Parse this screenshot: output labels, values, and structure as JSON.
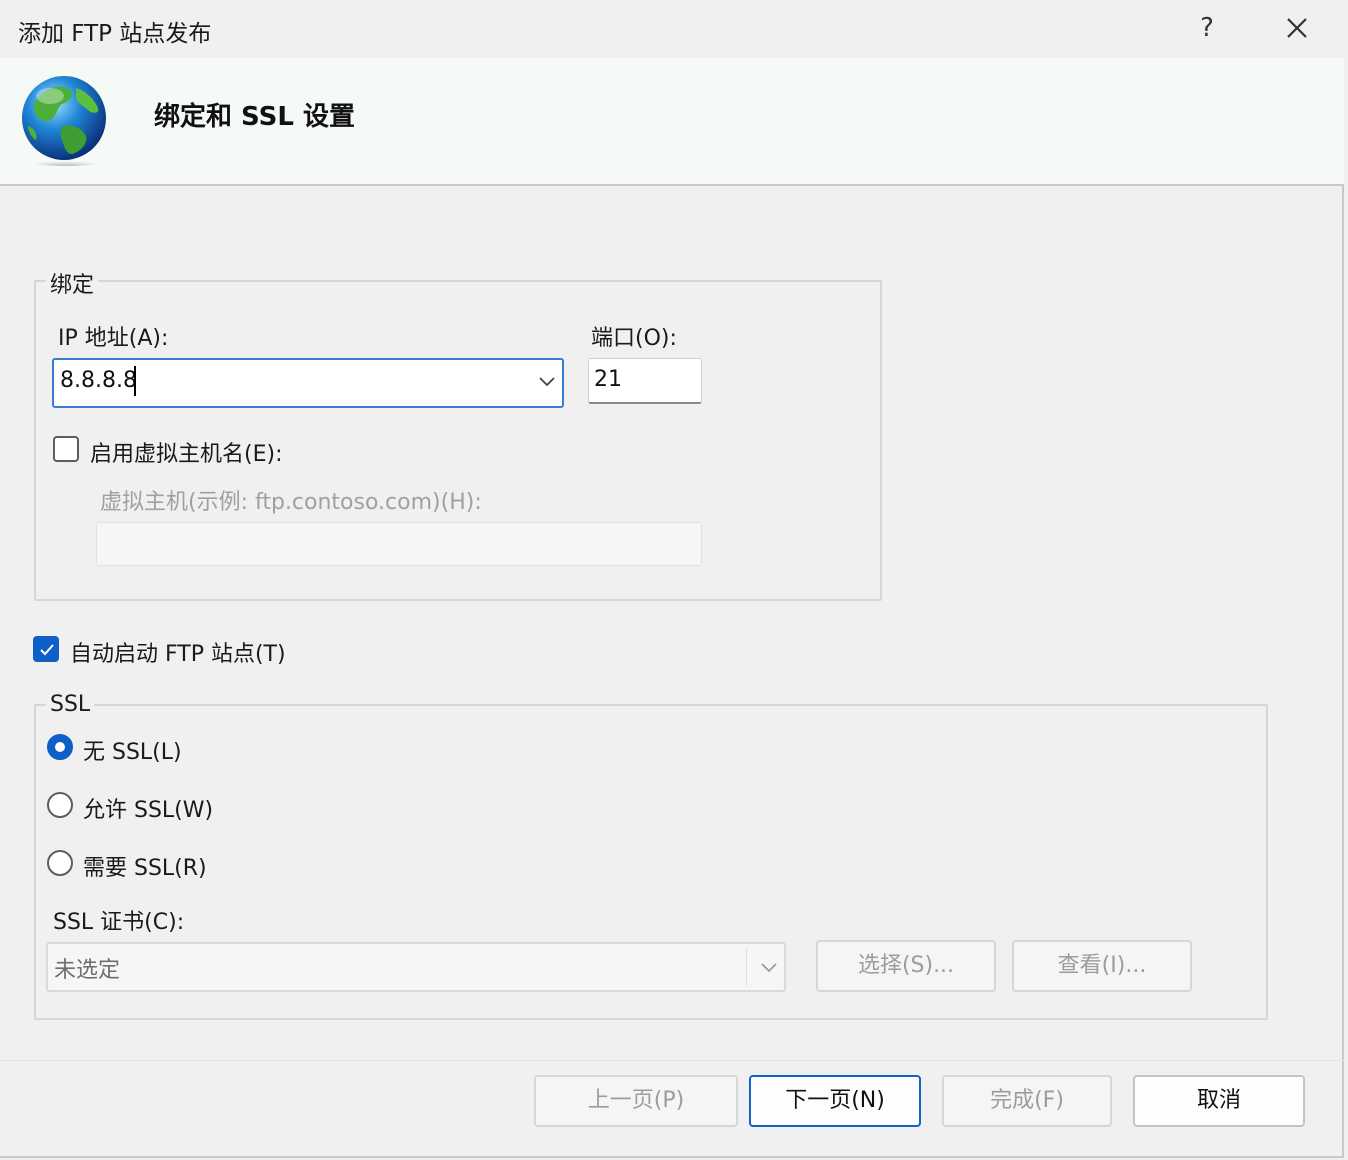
{
  "window": {
    "title": "添加 FTP 站点发布",
    "help_label": "?"
  },
  "header": {
    "title": "绑定和 SSL 设置",
    "icon": "globe-icon"
  },
  "binding": {
    "legend": "绑定",
    "ip_label": "IP 地址(A):",
    "ip_value": "8.8.8.8",
    "port_label": "端口(O):",
    "port_value": "21",
    "virtual_host_checkbox_label": "启用虚拟主机名(E):",
    "virtual_host_checked": false,
    "virtual_host_label": "虚拟主机(示例: ftp.contoso.com)(H):",
    "virtual_host_value": ""
  },
  "autostart": {
    "label": "自动启动 FTP 站点(T)",
    "checked": true
  },
  "ssl": {
    "legend": "SSL",
    "options": [
      {
        "label": "无 SSL(L)",
        "selected": true
      },
      {
        "label": "允许 SSL(W)",
        "selected": false
      },
      {
        "label": "需要 SSL(R)",
        "selected": false
      }
    ],
    "cert_label": "SSL 证书(C):",
    "cert_value": "未选定",
    "select_button": "选择(S)...",
    "view_button": "查看(I)..."
  },
  "footer": {
    "prev_button": "上一页(P)",
    "next_button": "下一页(N)",
    "finish_button": "完成(F)",
    "cancel_button": "取消"
  },
  "colors": {
    "accent": "#0f5fc8",
    "header_bg": "#f6faf6",
    "dialog_bg": "#f0f0f0"
  }
}
